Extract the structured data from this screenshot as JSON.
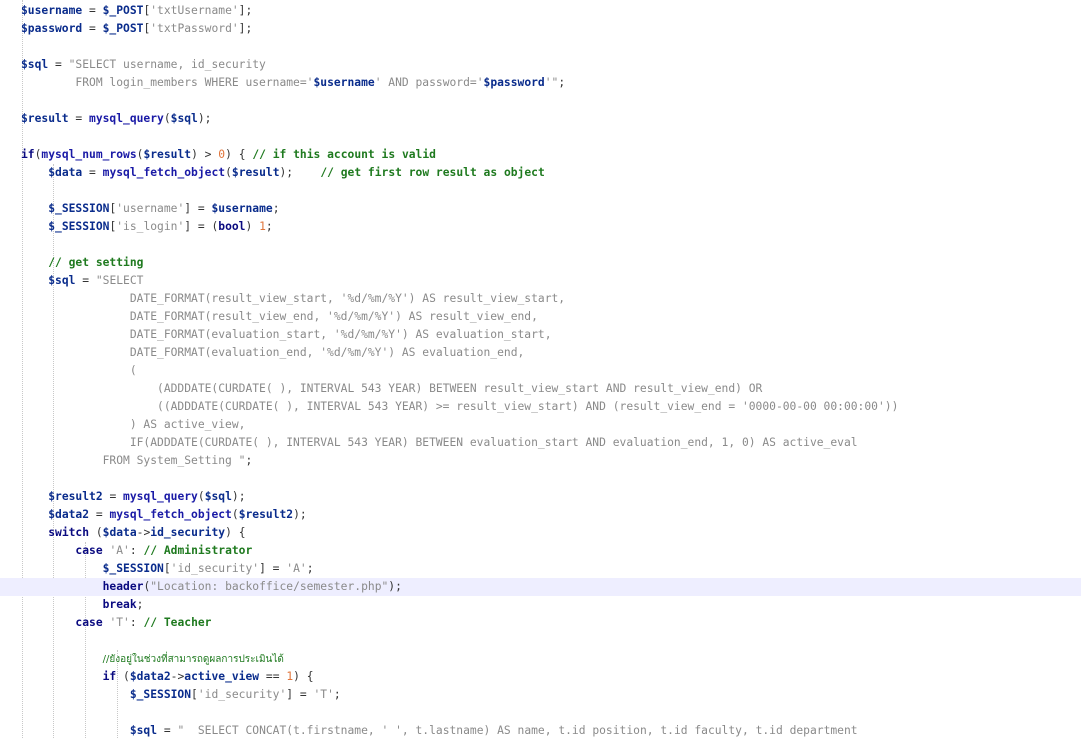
{
  "editor": {
    "highlighted_line": 32,
    "lines": [
      [
        [
          "var",
          "$username"
        ],
        [
          "op",
          " = "
        ],
        [
          "var",
          "$_POST"
        ],
        [
          "op",
          "["
        ],
        [
          "str",
          "'txtUsername'"
        ],
        [
          "op",
          "];"
        ]
      ],
      [
        [
          "var",
          "$password"
        ],
        [
          "op",
          " = "
        ],
        [
          "var",
          "$_POST"
        ],
        [
          "op",
          "["
        ],
        [
          "str",
          "'txtPassword'"
        ],
        [
          "op",
          "];"
        ]
      ],
      [],
      [
        [
          "var",
          "$sql"
        ],
        [
          "op",
          " = "
        ],
        [
          "str",
          "\"SELECT username, id_security"
        ]
      ],
      [
        [
          "str",
          "        FROM login_members WHERE username='"
        ],
        [
          "var",
          "$username"
        ],
        [
          "str",
          "' AND password='"
        ],
        [
          "var",
          "$password"
        ],
        [
          "str",
          "'\""
        ],
        [
          "op",
          ";"
        ]
      ],
      [],
      [
        [
          "var",
          "$result"
        ],
        [
          "op",
          " = "
        ],
        [
          "fn",
          "mysql_query"
        ],
        [
          "op",
          "("
        ],
        [
          "var",
          "$sql"
        ],
        [
          "op",
          ");"
        ]
      ],
      [],
      [
        [
          "kw",
          "if"
        ],
        [
          "op",
          "("
        ],
        [
          "fn",
          "mysql_num_rows"
        ],
        [
          "op",
          "("
        ],
        [
          "var",
          "$result"
        ],
        [
          "op",
          ") > "
        ],
        [
          "num",
          "0"
        ],
        [
          "op",
          ") { "
        ],
        [
          "com",
          "// if this account is valid"
        ]
      ],
      [
        [
          "plain",
          "    "
        ],
        [
          "var",
          "$data"
        ],
        [
          "op",
          " = "
        ],
        [
          "fn",
          "mysql_fetch_object"
        ],
        [
          "op",
          "("
        ],
        [
          "var",
          "$result"
        ],
        [
          "op",
          ");    "
        ],
        [
          "com",
          "// get first row result as object"
        ]
      ],
      [],
      [
        [
          "plain",
          "    "
        ],
        [
          "var",
          "$_SESSION"
        ],
        [
          "op",
          "["
        ],
        [
          "str",
          "'username'"
        ],
        [
          "op",
          "] = "
        ],
        [
          "var",
          "$username"
        ],
        [
          "op",
          ";"
        ]
      ],
      [
        [
          "plain",
          "    "
        ],
        [
          "var",
          "$_SESSION"
        ],
        [
          "op",
          "["
        ],
        [
          "str",
          "'is_login'"
        ],
        [
          "op",
          "] = ("
        ],
        [
          "kw",
          "bool"
        ],
        [
          "op",
          ") "
        ],
        [
          "num",
          "1"
        ],
        [
          "op",
          ";"
        ]
      ],
      [],
      [
        [
          "plain",
          "    "
        ],
        [
          "com",
          "// get setting"
        ]
      ],
      [
        [
          "plain",
          "    "
        ],
        [
          "var",
          "$sql"
        ],
        [
          "op",
          " = "
        ],
        [
          "str",
          "\"SELECT"
        ]
      ],
      [
        [
          "str",
          "                DATE_FORMAT(result_view_start, '%d/%m/%Y') AS result_view_start,"
        ]
      ],
      [
        [
          "str",
          "                DATE_FORMAT(result_view_end, '%d/%m/%Y') AS result_view_end,"
        ]
      ],
      [
        [
          "str",
          "                DATE_FORMAT(evaluation_start, '%d/%m/%Y') AS evaluation_start,"
        ]
      ],
      [
        [
          "str",
          "                DATE_FORMAT(evaluation_end, '%d/%m/%Y') AS evaluation_end,"
        ]
      ],
      [
        [
          "str",
          "                ("
        ]
      ],
      [
        [
          "str",
          "                    (ADDDATE(CURDATE( ), INTERVAL 543 YEAR) BETWEEN result_view_start AND result_view_end) OR"
        ]
      ],
      [
        [
          "str",
          "                    ((ADDDATE(CURDATE( ), INTERVAL 543 YEAR) >= result_view_start) AND (result_view_end = '0000-00-00 00:00:00'))"
        ]
      ],
      [
        [
          "str",
          "                ) AS active_view,"
        ]
      ],
      [
        [
          "str",
          "                IF(ADDDATE(CURDATE( ), INTERVAL 543 YEAR) BETWEEN evaluation_start AND evaluation_end, 1, 0) AS active_eval"
        ]
      ],
      [
        [
          "str",
          "            FROM System_Setting \""
        ],
        [
          "op",
          ";"
        ]
      ],
      [],
      [
        [
          "plain",
          "    "
        ],
        [
          "var",
          "$result2"
        ],
        [
          "op",
          " = "
        ],
        [
          "fn",
          "mysql_query"
        ],
        [
          "op",
          "("
        ],
        [
          "var",
          "$sql"
        ],
        [
          "op",
          ");"
        ]
      ],
      [
        [
          "plain",
          "    "
        ],
        [
          "var",
          "$data2"
        ],
        [
          "op",
          " = "
        ],
        [
          "fn",
          "mysql_fetch_object"
        ],
        [
          "op",
          "("
        ],
        [
          "var",
          "$result2"
        ],
        [
          "op",
          ");"
        ]
      ],
      [
        [
          "plain",
          "    "
        ],
        [
          "kw",
          "switch"
        ],
        [
          "op",
          " ("
        ],
        [
          "var",
          "$data"
        ],
        [
          "op",
          "->"
        ],
        [
          "var",
          "id_security"
        ],
        [
          "op",
          ") {"
        ]
      ],
      [
        [
          "plain",
          "        "
        ],
        [
          "kw",
          "case"
        ],
        [
          "op",
          " "
        ],
        [
          "str",
          "'A'"
        ],
        [
          "op",
          ": "
        ],
        [
          "com",
          "// Administrator"
        ]
      ],
      [
        [
          "plain",
          "            "
        ],
        [
          "var",
          "$_SESSION"
        ],
        [
          "op",
          "["
        ],
        [
          "str",
          "'id_security'"
        ],
        [
          "op",
          "] = "
        ],
        [
          "str",
          "'A'"
        ],
        [
          "op",
          ";"
        ]
      ],
      [
        [
          "plain",
          "            "
        ],
        [
          "kw",
          "header"
        ],
        [
          "op",
          "("
        ],
        [
          "str",
          "\"Location: backoffice/semester.php\""
        ],
        [
          "op",
          ");"
        ]
      ],
      [
        [
          "plain",
          "            "
        ],
        [
          "kw",
          "break"
        ],
        [
          "op",
          ";"
        ]
      ],
      [
        [
          "plain",
          "        "
        ],
        [
          "kw",
          "case"
        ],
        [
          "op",
          " "
        ],
        [
          "str",
          "'T'"
        ],
        [
          "op",
          ": "
        ],
        [
          "com",
          "// Teacher"
        ]
      ],
      [],
      [
        [
          "plain",
          "            "
        ],
        [
          "thai",
          "//ยังอยู่ในช่วงที่สามารถดูผลการประเมินได้"
        ]
      ],
      [
        [
          "plain",
          "            "
        ],
        [
          "kw",
          "if"
        ],
        [
          "op",
          " ("
        ],
        [
          "var",
          "$data2"
        ],
        [
          "op",
          "->"
        ],
        [
          "var",
          "active_view"
        ],
        [
          "op",
          " == "
        ],
        [
          "num",
          "1"
        ],
        [
          "op",
          ") {"
        ]
      ],
      [
        [
          "plain",
          "                "
        ],
        [
          "var",
          "$_SESSION"
        ],
        [
          "op",
          "["
        ],
        [
          "str",
          "'id_security'"
        ],
        [
          "op",
          "] = "
        ],
        [
          "str",
          "'T'"
        ],
        [
          "op",
          ";"
        ]
      ],
      [],
      [
        [
          "plain",
          "                "
        ],
        [
          "var",
          "$sql"
        ],
        [
          "op",
          " = "
        ],
        [
          "str",
          "\"  SELECT CONCAT(t.firstname, ' ', t.lastname) AS name, t.id position, t.id faculty, t.id department"
        ]
      ]
    ]
  }
}
